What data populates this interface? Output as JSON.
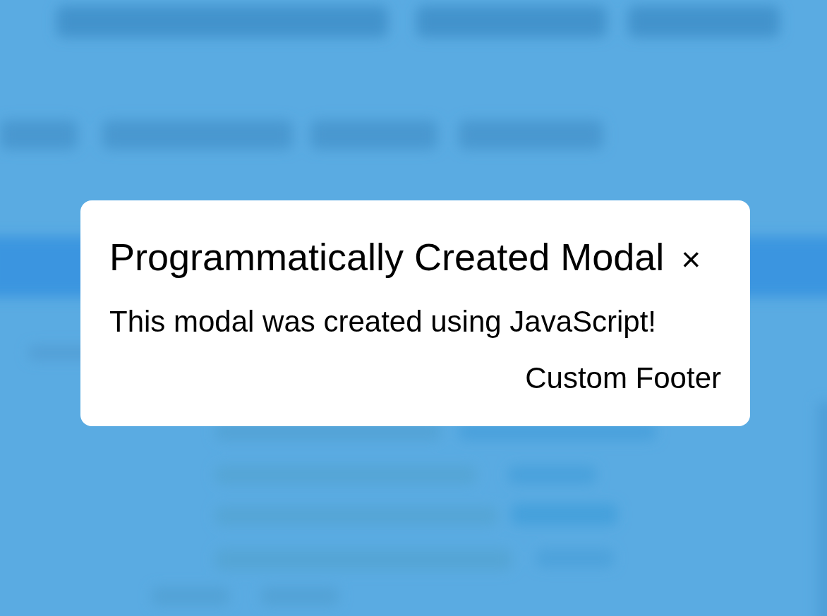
{
  "modal": {
    "title": "Programmatically Created Modal",
    "close_label": "×",
    "body": "This modal was created using JavaScript!",
    "footer": "Custom Footer"
  }
}
